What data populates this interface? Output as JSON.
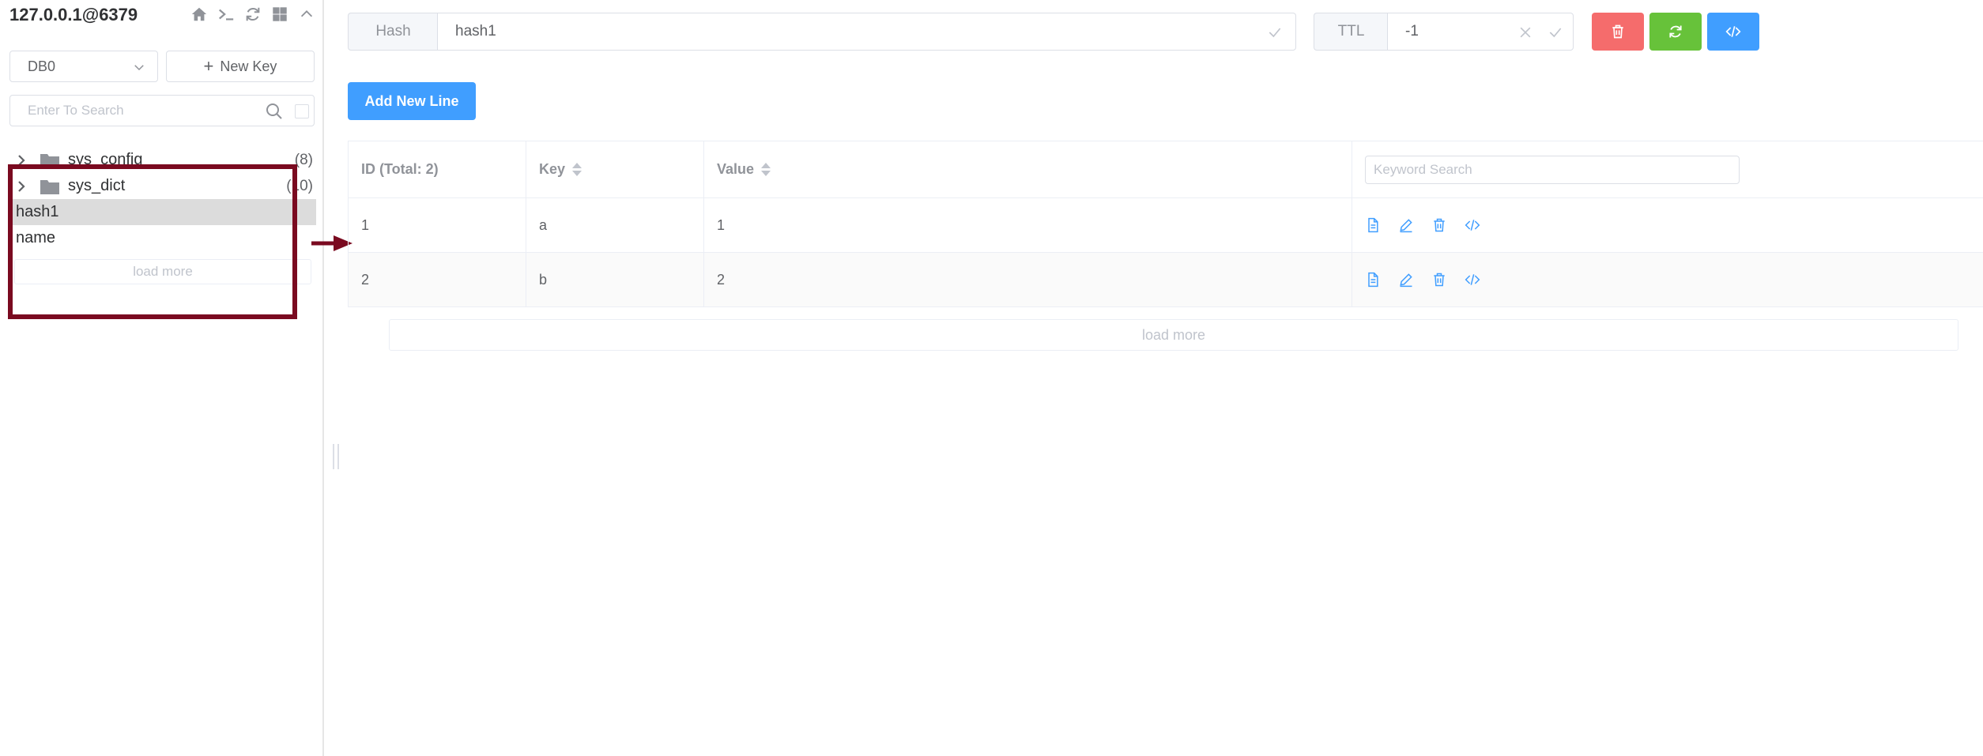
{
  "connection": {
    "title": "127.0.0.1@6379"
  },
  "toolbar_icons": [
    "home-icon",
    "terminal-icon",
    "refresh-icon",
    "grid-icon",
    "chevron-up-icon"
  ],
  "sidebar": {
    "db_select": "DB0",
    "new_key_label": "New Key",
    "search_placeholder": "Enter To Search",
    "tree": [
      {
        "label": "sys_config",
        "count": "(8)"
      },
      {
        "label": "sys_dict",
        "count": "(10)"
      }
    ],
    "keys": [
      "hash1",
      "name"
    ],
    "load_more": "load more"
  },
  "key_header": {
    "type": "Hash",
    "key_name": "hash1",
    "ttl_label": "TTL",
    "ttl_value": "-1"
  },
  "actions": {
    "add_line": "Add New Line"
  },
  "table": {
    "headers": {
      "id": "ID (Total: 2)",
      "key": "Key",
      "value": "Value"
    },
    "keyword_placeholder": "Keyword Search",
    "rows": [
      {
        "id": "1",
        "key": "a",
        "value": "1"
      },
      {
        "id": "2",
        "key": "b",
        "value": "2"
      }
    ],
    "load_more": "load more"
  },
  "colors": {
    "primary": "#409eff",
    "danger": "#f56c6c",
    "success": "#67c23a",
    "annotation": "#7a0a20",
    "selected_row": "#dcdcdc"
  }
}
